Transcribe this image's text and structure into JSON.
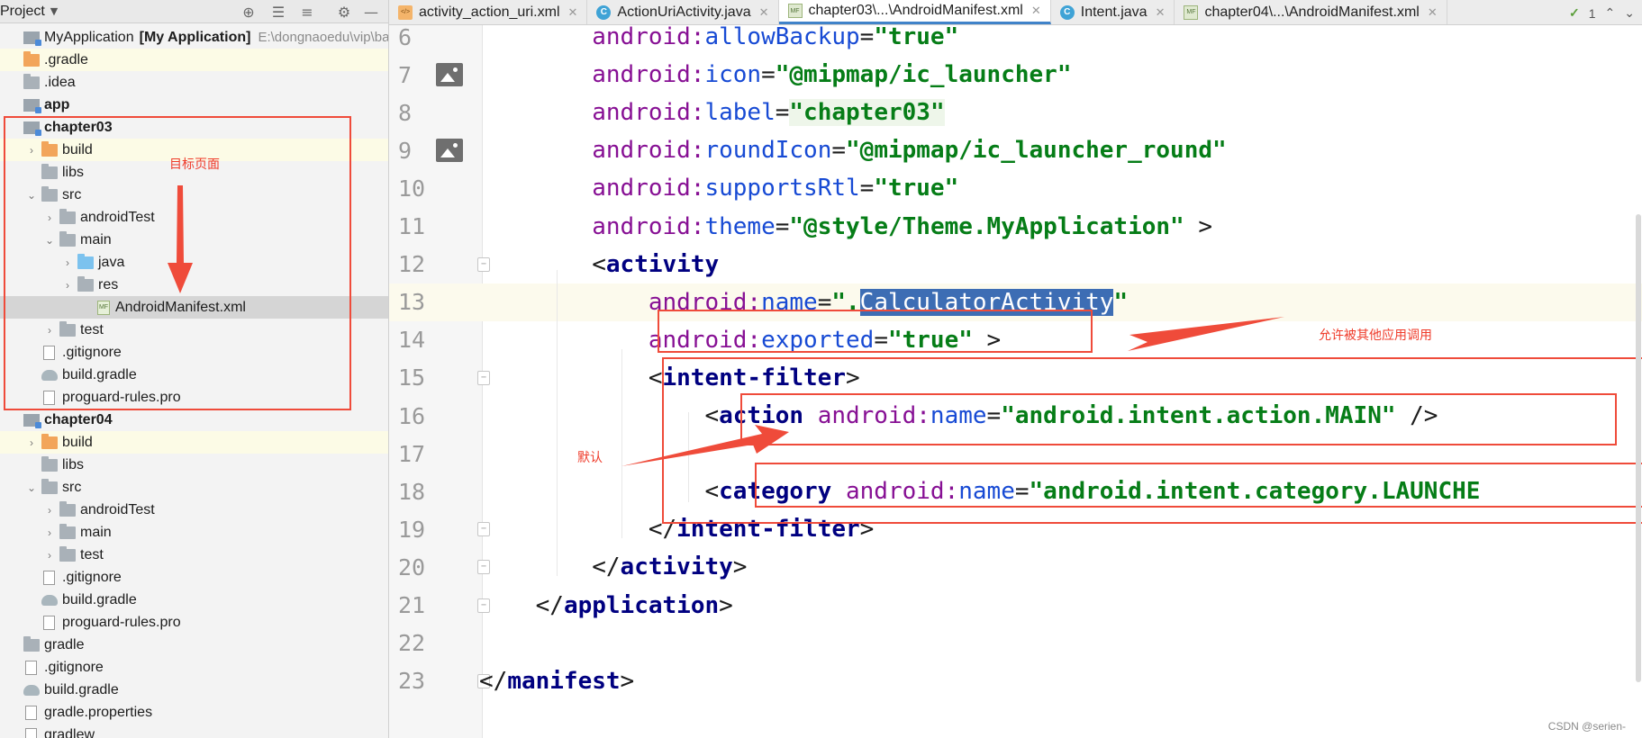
{
  "project_panel": {
    "title": "Project",
    "tree": [
      {
        "label": "MyApplication",
        "suffix": "[My Application]",
        "path": "E:\\dongnaoedu\\vip\\basi",
        "depth": 0,
        "icon": "module",
        "chevron": "",
        "bold_part": true
      },
      {
        "label": ".gradle",
        "depth": 0,
        "icon": "folder-orange",
        "chevron": "",
        "highlight": "yellow"
      },
      {
        "label": ".idea",
        "depth": 0,
        "icon": "folder",
        "chevron": ""
      },
      {
        "label": "app",
        "depth": 0,
        "icon": "module",
        "chevron": "",
        "bold": true
      },
      {
        "label": "chapter03",
        "depth": 0,
        "icon": "module",
        "chevron": "",
        "bold": true
      },
      {
        "label": "build",
        "depth": 1,
        "icon": "folder-orange",
        "chevron": ">",
        "highlight": "yellow"
      },
      {
        "label": "libs",
        "depth": 1,
        "icon": "folder",
        "chevron": ""
      },
      {
        "label": "src",
        "depth": 1,
        "icon": "folder",
        "chevron": "v"
      },
      {
        "label": "androidTest",
        "depth": 2,
        "icon": "folder",
        "chevron": ">"
      },
      {
        "label": "main",
        "depth": 2,
        "icon": "folder",
        "chevron": "v"
      },
      {
        "label": "java",
        "depth": 3,
        "icon": "folder-blue",
        "chevron": ">"
      },
      {
        "label": "res",
        "depth": 3,
        "icon": "folder",
        "chevron": ">"
      },
      {
        "label": "AndroidManifest.xml",
        "depth": 4,
        "icon": "mf",
        "chevron": "",
        "highlight": "selected"
      },
      {
        "label": "test",
        "depth": 2,
        "icon": "folder",
        "chevron": ">"
      },
      {
        "label": ".gitignore",
        "depth": 1,
        "icon": "file",
        "chevron": ""
      },
      {
        "label": "build.gradle",
        "depth": 1,
        "icon": "gradle",
        "chevron": ""
      },
      {
        "label": "proguard-rules.pro",
        "depth": 1,
        "icon": "file",
        "chevron": ""
      },
      {
        "label": "chapter04",
        "depth": 0,
        "icon": "module",
        "chevron": "",
        "bold": true
      },
      {
        "label": "build",
        "depth": 1,
        "icon": "folder-orange",
        "chevron": ">",
        "highlight": "yellow"
      },
      {
        "label": "libs",
        "depth": 1,
        "icon": "folder",
        "chevron": ""
      },
      {
        "label": "src",
        "depth": 1,
        "icon": "folder",
        "chevron": "v"
      },
      {
        "label": "androidTest",
        "depth": 2,
        "icon": "folder",
        "chevron": ">"
      },
      {
        "label": "main",
        "depth": 2,
        "icon": "folder",
        "chevron": ">"
      },
      {
        "label": "test",
        "depth": 2,
        "icon": "folder",
        "chevron": ">"
      },
      {
        "label": ".gitignore",
        "depth": 1,
        "icon": "file",
        "chevron": ""
      },
      {
        "label": "build.gradle",
        "depth": 1,
        "icon": "gradle",
        "chevron": ""
      },
      {
        "label": "proguard-rules.pro",
        "depth": 1,
        "icon": "file",
        "chevron": ""
      },
      {
        "label": "gradle",
        "depth": 0,
        "icon": "folder",
        "chevron": ""
      },
      {
        "label": ".gitignore",
        "depth": 0,
        "icon": "file",
        "chevron": ""
      },
      {
        "label": "build.gradle",
        "depth": 0,
        "icon": "gradle",
        "chevron": ""
      },
      {
        "label": "gradle.properties",
        "depth": 0,
        "icon": "file",
        "chevron": ""
      },
      {
        "label": "gradlew",
        "depth": 0,
        "icon": "file",
        "chevron": ""
      }
    ]
  },
  "tabs": [
    {
      "label": "activity_action_uri.xml",
      "icon": "xml",
      "active": false
    },
    {
      "label": "ActionUriActivity.java",
      "icon": "class",
      "active": false
    },
    {
      "label": "chapter03\\...\\AndroidManifest.xml",
      "icon": "mf",
      "active": true
    },
    {
      "label": "Intent.java",
      "icon": "class",
      "active": false
    },
    {
      "label": "chapter04\\...\\AndroidManifest.xml",
      "icon": "mf",
      "active": false
    }
  ],
  "inspection": {
    "count": "1"
  },
  "editor": {
    "lines": [
      {
        "num": "6",
        "tokens": [
          [
            "ind",
            "        "
          ],
          [
            "ns",
            "android:"
          ],
          [
            "attr",
            "allowBackup"
          ],
          [
            "txt",
            "="
          ],
          [
            "str",
            "\"true\""
          ]
        ]
      },
      {
        "num": "7",
        "gutter_image": true,
        "tokens": [
          [
            "ind",
            "        "
          ],
          [
            "ns",
            "android:"
          ],
          [
            "attr",
            "icon"
          ],
          [
            "txt",
            "="
          ],
          [
            "str",
            "\"@mipmap/ic_launcher\""
          ]
        ]
      },
      {
        "num": "8",
        "tokens": [
          [
            "ind",
            "        "
          ],
          [
            "ns",
            "android:"
          ],
          [
            "attr",
            "label"
          ],
          [
            "txt",
            "="
          ],
          [
            "str-label",
            "\"chapter03\""
          ]
        ]
      },
      {
        "num": "9",
        "gutter_image": true,
        "tokens": [
          [
            "ind",
            "        "
          ],
          [
            "ns",
            "android:"
          ],
          [
            "attr",
            "roundIcon"
          ],
          [
            "txt",
            "="
          ],
          [
            "str",
            "\"@mipmap/ic_launcher_round\""
          ]
        ]
      },
      {
        "num": "10",
        "tokens": [
          [
            "ind",
            "        "
          ],
          [
            "ns",
            "android:"
          ],
          [
            "attr",
            "supportsRtl"
          ],
          [
            "txt",
            "="
          ],
          [
            "str",
            "\"true\""
          ]
        ]
      },
      {
        "num": "11",
        "tokens": [
          [
            "ind",
            "        "
          ],
          [
            "ns",
            "android:"
          ],
          [
            "attr",
            "theme"
          ],
          [
            "txt",
            "="
          ],
          [
            "str",
            "\"@style/Theme.MyApplication\""
          ],
          [
            "txt",
            " >"
          ]
        ]
      },
      {
        "num": "12",
        "fold": true,
        "tokens": [
          [
            "ind",
            "        "
          ],
          [
            "txt",
            "<"
          ],
          [
            "tag",
            "activity"
          ]
        ]
      },
      {
        "num": "13",
        "current": true,
        "tokens": [
          [
            "ind",
            "            "
          ],
          [
            "ns",
            "android:"
          ],
          [
            "attr",
            "name"
          ],
          [
            "txt",
            "="
          ],
          [
            "str",
            "\"."
          ],
          [
            "sel",
            "CalculatorActivity"
          ],
          [
            "str",
            "\""
          ]
        ]
      },
      {
        "num": "14",
        "tokens": [
          [
            "ind",
            "            "
          ],
          [
            "ns",
            "android:"
          ],
          [
            "attr",
            "exported"
          ],
          [
            "txt",
            "="
          ],
          [
            "str",
            "\"true\""
          ],
          [
            "txt",
            " >"
          ]
        ]
      },
      {
        "num": "15",
        "fold": true,
        "tokens": [
          [
            "ind",
            "            "
          ],
          [
            "txt",
            "<"
          ],
          [
            "tag",
            "intent-filter"
          ],
          [
            "txt",
            ">"
          ]
        ]
      },
      {
        "num": "16",
        "tokens": [
          [
            "ind",
            "                "
          ],
          [
            "txt",
            "<"
          ],
          [
            "tag",
            "action "
          ],
          [
            "ns",
            "android:"
          ],
          [
            "attr",
            "name"
          ],
          [
            "txt",
            "="
          ],
          [
            "str",
            "\"android.intent.action.MAIN\""
          ],
          [
            "txt",
            " />"
          ]
        ]
      },
      {
        "num": "17",
        "tokens": []
      },
      {
        "num": "18",
        "tokens": [
          [
            "ind",
            "                "
          ],
          [
            "txt",
            "<"
          ],
          [
            "tag",
            "category "
          ],
          [
            "ns",
            "android:"
          ],
          [
            "attr",
            "name"
          ],
          [
            "txt",
            "="
          ],
          [
            "str",
            "\"android.intent.category.LAUNCHE"
          ]
        ]
      },
      {
        "num": "19",
        "fold": true,
        "tokens": [
          [
            "ind",
            "            "
          ],
          [
            "txt",
            "</"
          ],
          [
            "tag",
            "intent-filter"
          ],
          [
            "txt",
            ">"
          ]
        ]
      },
      {
        "num": "20",
        "fold": true,
        "tokens": [
          [
            "ind",
            "        "
          ],
          [
            "txt",
            "</"
          ],
          [
            "tag",
            "activity"
          ],
          [
            "txt",
            ">"
          ]
        ]
      },
      {
        "num": "21",
        "fold": true,
        "tokens": [
          [
            "ind",
            "    "
          ],
          [
            "txt",
            "</"
          ],
          [
            "tag",
            "application"
          ],
          [
            "txt",
            ">"
          ]
        ]
      },
      {
        "num": "22",
        "tokens": []
      },
      {
        "num": "23",
        "fold": true,
        "tokens": [
          [
            "txt",
            "</"
          ],
          [
            "tag",
            "manifest"
          ],
          [
            "txt",
            ">"
          ]
        ]
      }
    ]
  },
  "annotations": {
    "target_page": "目标页面",
    "allow_other_apps": "允许被其他应用调用",
    "default": "默认"
  },
  "watermark": "CSDN @serien-",
  "colors": {
    "annotation_red": "#ef4b3a",
    "selection": "#3d6db4",
    "tab_active_underline": "#4083c9"
  }
}
